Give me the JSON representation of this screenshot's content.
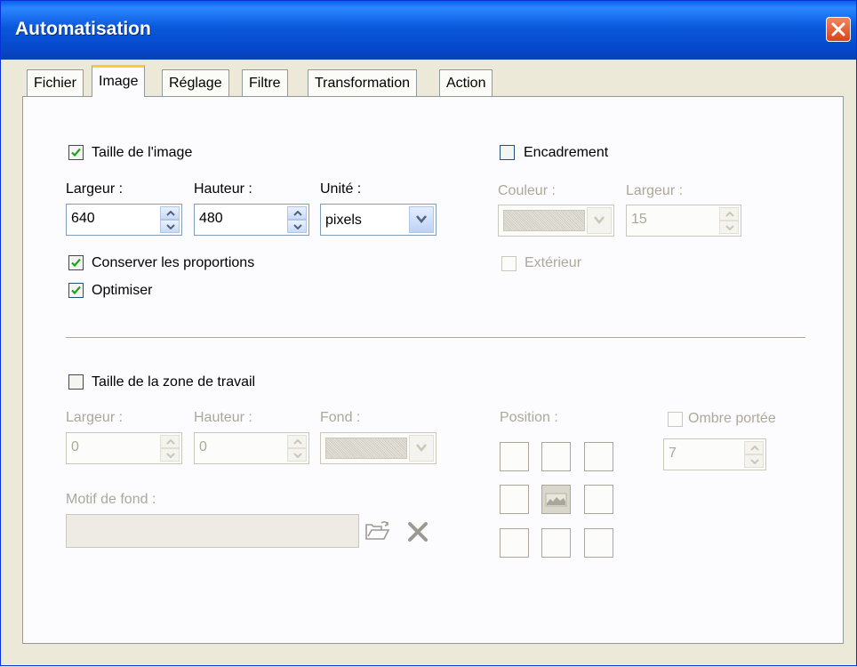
{
  "window": {
    "title": "Automatisation"
  },
  "tabs": [
    "Fichier",
    "Image",
    "Réglage",
    "Filtre",
    "Transformation",
    "Action"
  ],
  "image_size": {
    "label": "Taille de l'image",
    "checked": true,
    "width_label": "Largeur :",
    "width": "640",
    "height_label": "Hauteur :",
    "height": "480",
    "unit_label": "Unité :",
    "unit": "pixels",
    "keep_ratio_label": "Conserver les proportions",
    "keep_ratio": true,
    "optimize_label": "Optimiser",
    "optimize": true
  },
  "frame": {
    "label": "Encadrement",
    "checked": false,
    "color_label": "Couleur :",
    "width_label": "Largeur :",
    "width": "15",
    "exterior_label": "Extérieur",
    "exterior": false
  },
  "canvas": {
    "label": "Taille de la zone de travail",
    "checked": false,
    "width_label": "Largeur :",
    "width": "0",
    "height_label": "Hauteur :",
    "height": "0",
    "bg_label": "Fond :",
    "pattern_label": "Motif de fond :",
    "pattern": "",
    "position_label": "Position :",
    "shadow_label": "Ombre portée",
    "shadow": false,
    "shadow_value": "7"
  },
  "icons": {
    "close": "close-icon",
    "folder": "open-folder-icon",
    "delete": "delete-x-icon",
    "check": "checkmark-icon"
  },
  "colors": {
    "titlebar": "#0a58dc",
    "active_tab_accent": "#ffc83c",
    "disabled_text": "#aca899",
    "close_button": "#d8431b"
  }
}
